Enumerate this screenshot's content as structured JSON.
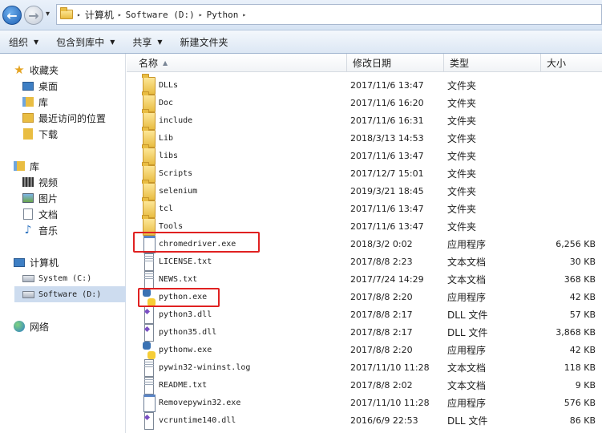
{
  "window": {
    "breadcrumb": [
      "计算机",
      "Software (D:)",
      "Python"
    ]
  },
  "toolbar": {
    "organize_label": "组织",
    "include_label": "包含到库中",
    "share_label": "共享",
    "new_folder_label": "新建文件夹"
  },
  "sidebar": {
    "favorites": {
      "label": "收藏夹",
      "items": [
        {
          "label": "桌面",
          "icon": "desktop-icon"
        },
        {
          "label": "库",
          "icon": "library-icon"
        },
        {
          "label": "最近访问的位置",
          "icon": "recent-places-icon"
        },
        {
          "label": "下载",
          "icon": "downloads-icon"
        }
      ]
    },
    "libraries": {
      "label": "库",
      "items": [
        {
          "label": "视频",
          "icon": "video-icon"
        },
        {
          "label": "图片",
          "icon": "pictures-icon"
        },
        {
          "label": "文档",
          "icon": "documents-icon"
        },
        {
          "label": "音乐",
          "icon": "music-icon"
        }
      ]
    },
    "computer": {
      "label": "计算机",
      "items": [
        {
          "label": "System (C:)",
          "icon": "drive-icon"
        },
        {
          "label": "Software (D:)",
          "icon": "drive-icon",
          "selected": true
        }
      ]
    },
    "network": {
      "label": "网络"
    }
  },
  "columns": {
    "name": "名称",
    "date": "修改日期",
    "type": "类型",
    "size": "大小"
  },
  "files": [
    {
      "name": "DLLs",
      "date": "2017/11/6 13:47",
      "type": "文件夹",
      "size": "",
      "icon": "folder-icon"
    },
    {
      "name": "Doc",
      "date": "2017/11/6 16:20",
      "type": "文件夹",
      "size": "",
      "icon": "folder-icon"
    },
    {
      "name": "include",
      "date": "2017/11/6 16:31",
      "type": "文件夹",
      "size": "",
      "icon": "folder-icon"
    },
    {
      "name": "Lib",
      "date": "2018/3/13 14:53",
      "type": "文件夹",
      "size": "",
      "icon": "folder-icon"
    },
    {
      "name": "libs",
      "date": "2017/11/6 13:47",
      "type": "文件夹",
      "size": "",
      "icon": "folder-icon"
    },
    {
      "name": "Scripts",
      "date": "2017/12/7 15:01",
      "type": "文件夹",
      "size": "",
      "icon": "folder-icon"
    },
    {
      "name": "selenium",
      "date": "2019/3/21 18:45",
      "type": "文件夹",
      "size": "",
      "icon": "folder-icon"
    },
    {
      "name": "tcl",
      "date": "2017/11/6 13:47",
      "type": "文件夹",
      "size": "",
      "icon": "folder-icon"
    },
    {
      "name": "Tools",
      "date": "2017/11/6 13:47",
      "type": "文件夹",
      "size": "",
      "icon": "folder-icon"
    },
    {
      "name": "chromedriver.exe",
      "date": "2018/3/2 0:02",
      "type": "应用程序",
      "size": "6,256 KB",
      "icon": "exe-icon",
      "highlighted": true
    },
    {
      "name": "LICENSE.txt",
      "date": "2017/8/8 2:23",
      "type": "文本文档",
      "size": "30 KB",
      "icon": "text-file-icon"
    },
    {
      "name": "NEWS.txt",
      "date": "2017/7/24 14:29",
      "type": "文本文档",
      "size": "368 KB",
      "icon": "text-file-icon"
    },
    {
      "name": "python.exe",
      "date": "2017/8/8 2:20",
      "type": "应用程序",
      "size": "42 KB",
      "icon": "python-icon",
      "highlighted": true
    },
    {
      "name": "python3.dll",
      "date": "2017/8/8 2:17",
      "type": "DLL 文件",
      "size": "57 KB",
      "icon": "dll-icon"
    },
    {
      "name": "python35.dll",
      "date": "2017/8/8 2:17",
      "type": "DLL 文件",
      "size": "3,868 KB",
      "icon": "dll-icon"
    },
    {
      "name": "pythonw.exe",
      "date": "2017/8/8 2:20",
      "type": "应用程序",
      "size": "42 KB",
      "icon": "python-icon"
    },
    {
      "name": "pywin32-wininst.log",
      "date": "2017/11/10 11:28",
      "type": "文本文档",
      "size": "118 KB",
      "icon": "text-file-icon"
    },
    {
      "name": "README.txt",
      "date": "2017/8/8 2:02",
      "type": "文本文档",
      "size": "9 KB",
      "icon": "text-file-icon"
    },
    {
      "name": "Removepywin32.exe",
      "date": "2017/11/10 11:28",
      "type": "应用程序",
      "size": "576 KB",
      "icon": "exe-icon"
    },
    {
      "name": "vcruntime140.dll",
      "date": "2016/6/9 22:53",
      "type": "DLL 文件",
      "size": "86 KB",
      "icon": "dll-icon"
    }
  ],
  "colors": {
    "highlight": "#e02121",
    "selected": "#cddcef",
    "accent": "#1d5fb3"
  }
}
